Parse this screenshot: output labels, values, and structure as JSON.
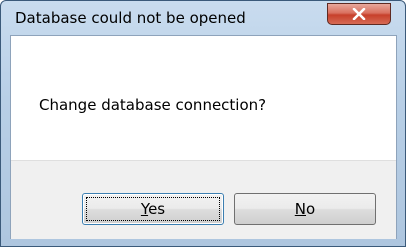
{
  "dialog": {
    "title": "Database could not be opened",
    "message": "Change database connection?",
    "buttons": {
      "yes": {
        "label_first": "Y",
        "label_rest": "es"
      },
      "no": {
        "label_first": "N",
        "label_rest": "o"
      }
    },
    "close_icon": "close-x",
    "colors": {
      "frame": "#b8cfe6",
      "close_button": "#c7402b",
      "footer": "#f0f0f0",
      "default_button_border": "#3c7fb1"
    }
  }
}
